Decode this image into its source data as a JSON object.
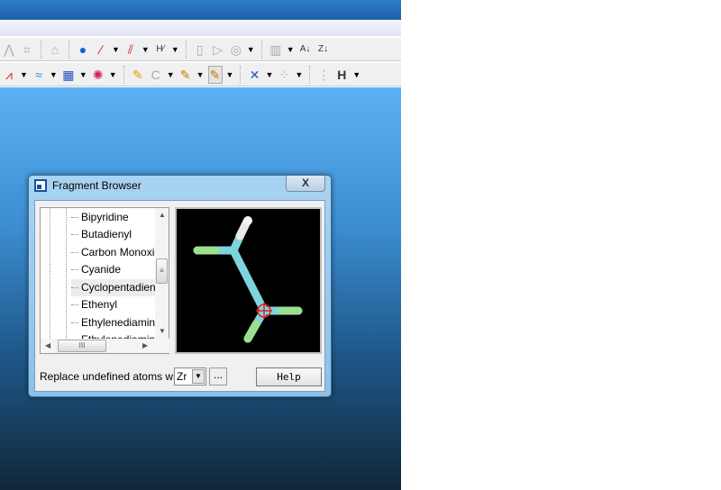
{
  "toolbar1": {
    "icons": [
      "spectrum-icon",
      "structure-icon",
      "home-icon",
      "add-atom-icon",
      "bond-icon",
      "double-bond-icon",
      "h-bond-icon",
      "document-icon",
      "play-icon",
      "record-icon",
      "chart-icon",
      "sort-az-icon",
      "sort-za-icon"
    ]
  },
  "toolbar2": {
    "icons": [
      "spectrum-plot-icon",
      "orbital-icon",
      "table-icon",
      "molecule-icon",
      "pencil-icon",
      "element-c-icon",
      "draw-ring-icon",
      "draw-chain-icon",
      "clean-icon",
      "atoms-icon",
      "grid-icon",
      "hydrogen-icon"
    ],
    "element_label": "C",
    "hydrogen_label": "H"
  },
  "dialog": {
    "title": "Fragment Browser",
    "close_label": "X",
    "tree_items": [
      "Bipyridine",
      "Butadienyl",
      "Carbon Monoxide",
      "Cyanide",
      "Cyclopentadienyl",
      "Ethenyl",
      "Ethylenediamine",
      "Ethylenediamine"
    ],
    "selected_item": "Cyclopentadienyl",
    "replace_label": "Replace undefined atoms with",
    "atom_value": "Zr",
    "more_label": "...",
    "help_label": "Help",
    "colors": {
      "carbon": "#7fd3dc",
      "fluorine": "#9be08f",
      "hydrogen": "#e8e8e8",
      "cursor": "#e02020"
    }
  }
}
